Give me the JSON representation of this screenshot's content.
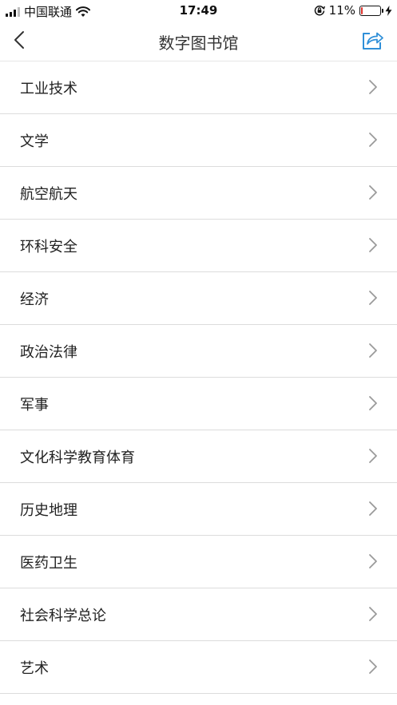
{
  "status_bar": {
    "carrier": "中国联通",
    "time": "17:49",
    "battery": "11%",
    "battery_level": 0.11,
    "battery_color": "#e0322b"
  },
  "nav": {
    "title": "数字图书馆",
    "back_icon": "chevron-left-icon",
    "share_icon": "share-icon",
    "accent_color": "#2f8fd8"
  },
  "categories": [
    {
      "label": "工业技术"
    },
    {
      "label": "文学"
    },
    {
      "label": "航空航天"
    },
    {
      "label": "环科安全"
    },
    {
      "label": "经济"
    },
    {
      "label": "政治法律"
    },
    {
      "label": "军事"
    },
    {
      "label": "文化科学教育体育"
    },
    {
      "label": "历史地理"
    },
    {
      "label": "医药卫生"
    },
    {
      "label": "社会科学总论"
    },
    {
      "label": "艺术"
    }
  ]
}
